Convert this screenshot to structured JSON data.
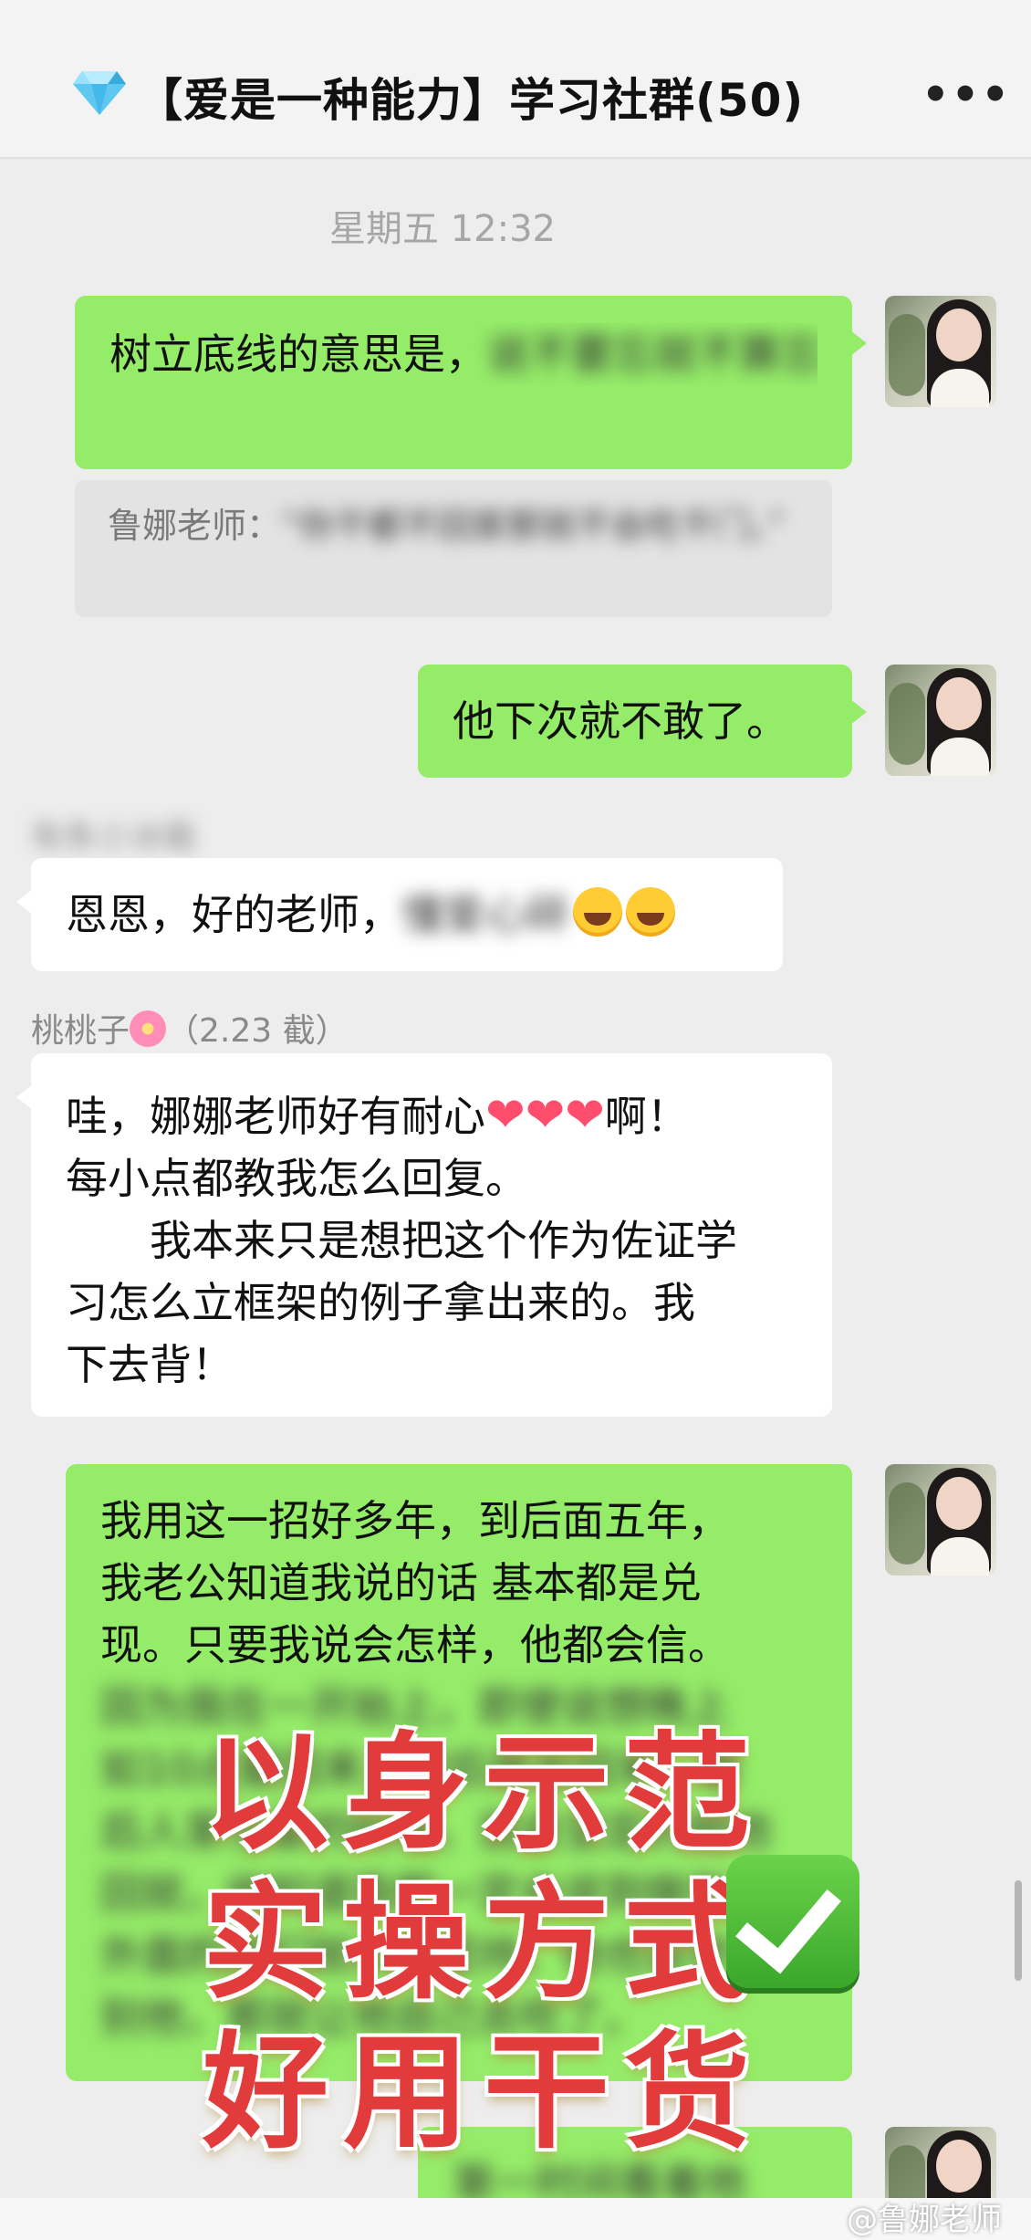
{
  "header": {
    "title": "【爱是一种能力】学习社群(50)",
    "more_icon": "more-dots-icon",
    "more_glyph": "•••"
  },
  "timestamp": "星期五 12:32",
  "messages": {
    "m1": {
      "visible_text": "树立底线的意思是，",
      "blurred_text": "说不要忘就不算忘！晚回来，就就该带你"
    },
    "quote1": {
      "prefix": "鲁娜老师：",
      "blurred_text": "“你干都不回家那就不会吃干门。”"
    },
    "m2": {
      "text": "他下次就不敢了。"
    },
    "m3": {
      "sender_blurred": "有条小冰箱",
      "visible_text": "恩恩，好的老师，",
      "blurred_text": "懂爱心碎"
    },
    "m4": {
      "sender": "桃桃子",
      "sender_suffix": "（2.23 截）",
      "line1_a": "哇，娜娜老师好有耐心",
      "hearts": "❤❤❤",
      "line1_b": "啊！",
      "line2": "每小点都教我怎么回复。",
      "line3": "　　我本来只是想把这个作为佐证学",
      "line4": "习怎么立框架的例子拿出来的。我",
      "line5": "下去背！"
    },
    "m5": {
      "line1": "我用这一招好多年，到后面五年，",
      "line2": "我老公知道我说的话 基本都是兑",
      "line3": "现。只要我说会怎样，他都会信。",
      "blurred_lines": [
        "因为我在一开始上，即使说想晚上",
        "如10点要回来，最后是会回来。最",
        "后人家也要的时候，我会坚定的把他",
        "回就，他知道我都一定会说到做到。",
        "外面的我们就认真坚持，他也会觉得",
        "别他，那就让他自己去吃了。"
      ]
    },
    "m6": {
      "blurred_text": "第一时间看着他"
    }
  },
  "overlay": {
    "line1": "以身示范",
    "line2": "实操方式",
    "line3": "好用干货",
    "check_icon": "check-mark-icon"
  },
  "watermark": "@鲁娜老师"
}
